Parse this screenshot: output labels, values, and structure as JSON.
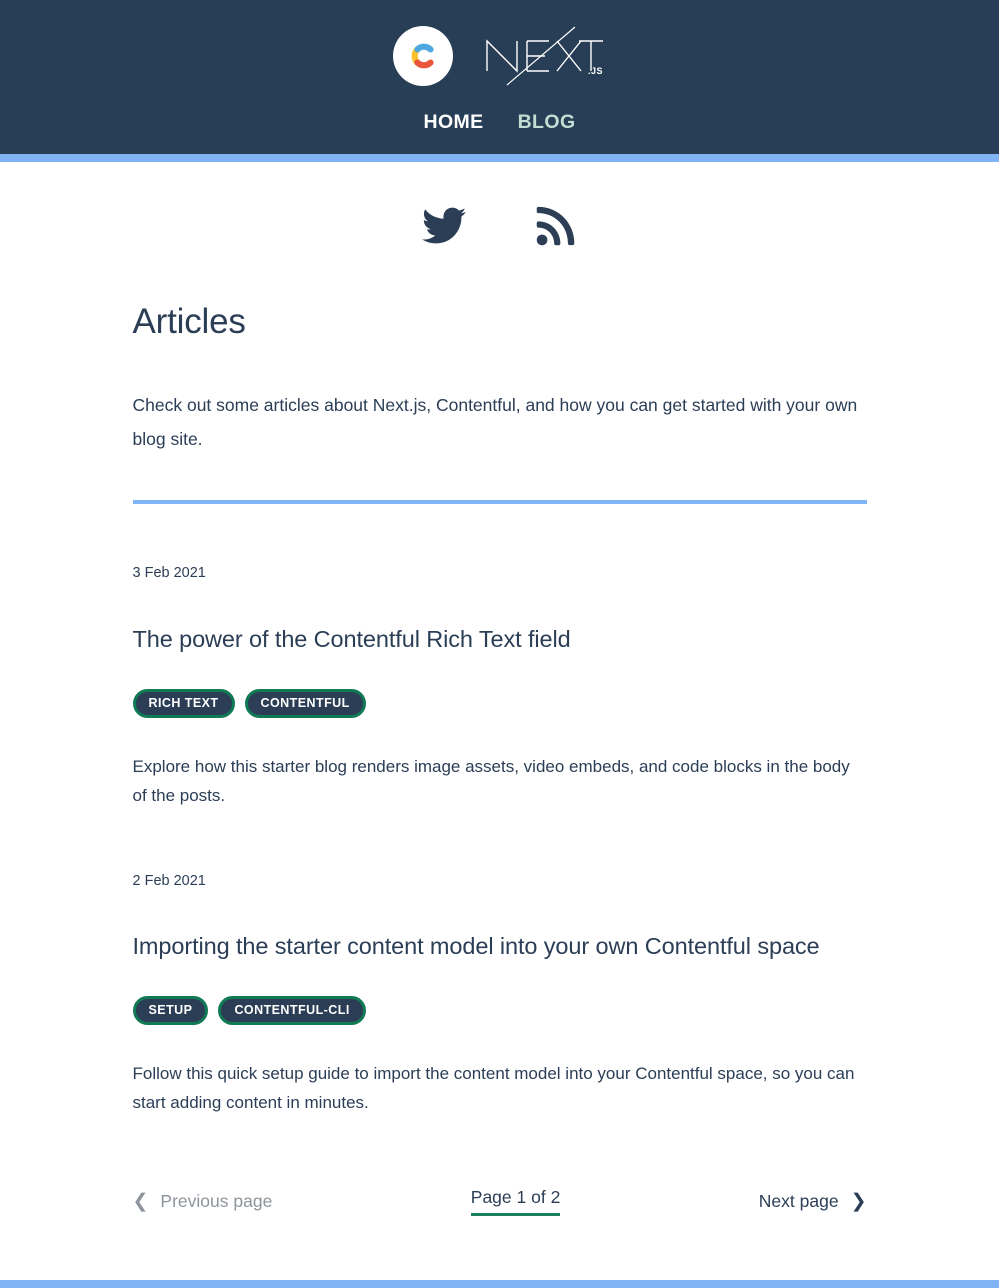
{
  "header": {
    "brand": {
      "contentful_logo": "contentful-logo-icon",
      "nextjs_logo": "nextjs-logo-icon",
      "nextjs_wordmark": "NEXT",
      "nextjs_suffix": ".JS"
    },
    "nav": [
      {
        "label": "HOME",
        "name": "nav-link-home",
        "state": "default"
      },
      {
        "label": "BLOG",
        "name": "nav-link-blog",
        "state": "active"
      }
    ],
    "accent_bar_color": "#81b4f4",
    "background_color": "#283e56"
  },
  "social": [
    {
      "name": "twitter-icon",
      "label": "Twitter"
    },
    {
      "name": "rss-icon",
      "label": "RSS feed"
    }
  ],
  "main": {
    "title": "Articles",
    "intro": "Check out some articles about Next.js, Contentful, and how you can get started with your own blog site.",
    "divider_color": "#81b4f4",
    "articles": [
      {
        "date": "3 Feb 2021",
        "title": "The power of the Contentful Rich Text field",
        "tags": [
          "RICH TEXT",
          "CONTENTFUL"
        ],
        "excerpt": "Explore how this starter blog renders image assets, video embeds, and code blocks in the body of the posts."
      },
      {
        "date": "2 Feb 2021",
        "title": "Importing the starter content model into your own Contentful space",
        "tags": [
          "SETUP",
          "CONTENTFUL-CLI"
        ],
        "excerpt": "Follow this quick setup guide to import the content model into your Contentful space, so you can start adding content in minutes."
      }
    ]
  },
  "pagination": {
    "previous_label": "Previous page",
    "previous_enabled": false,
    "indicator": "Page 1 of 2",
    "next_label": "Next page",
    "next_enabled": true,
    "indicator_underline_color": "#18805c"
  },
  "colors": {
    "navy": "#2b3e56",
    "header_navy": "#283e56",
    "accent_blue": "#81b4f4",
    "tag_green": "#107a54",
    "nav_active_green": "#c3ddd2",
    "muted_gray": "#8e949c"
  }
}
